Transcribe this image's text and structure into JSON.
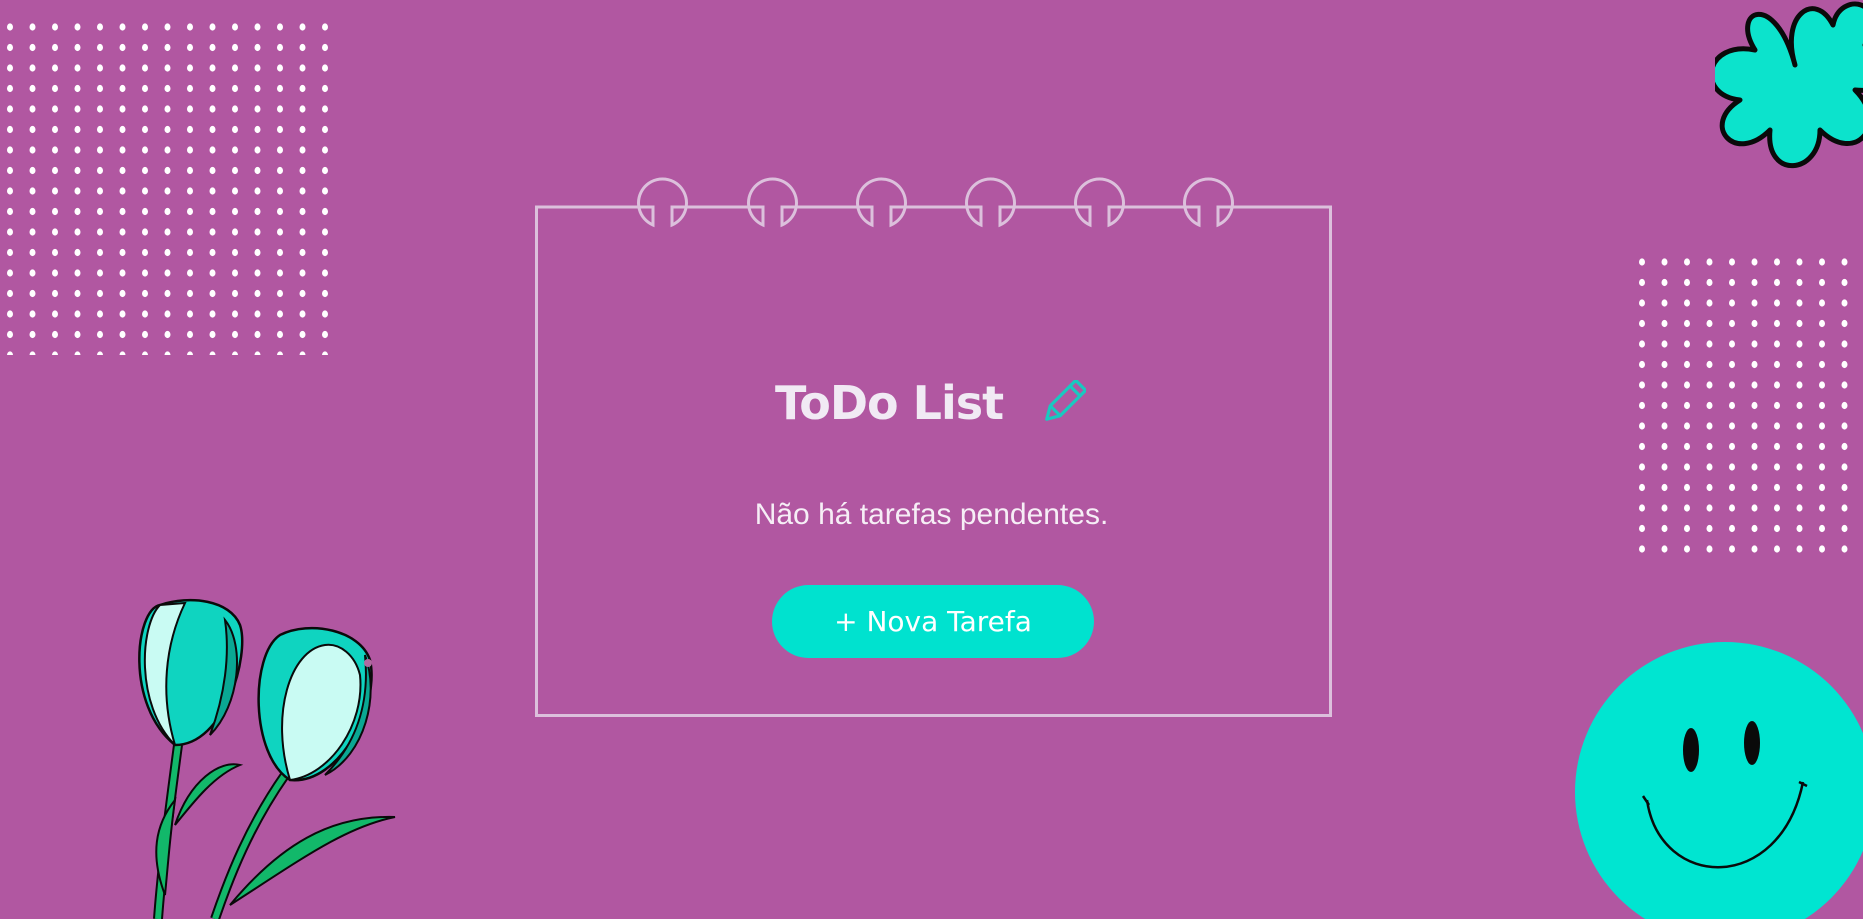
{
  "app": {
    "title": "ToDo List",
    "empty_message": "Não há tarefas pendentes.",
    "new_task_label": "+ Nova Tarefa"
  },
  "icons": {
    "title_icon": "pencil-icon"
  },
  "colors": {
    "background": "#b157a1",
    "accent": "#00e2cf",
    "card_outline": "#dcc0dc",
    "text": "#f6eef6"
  }
}
